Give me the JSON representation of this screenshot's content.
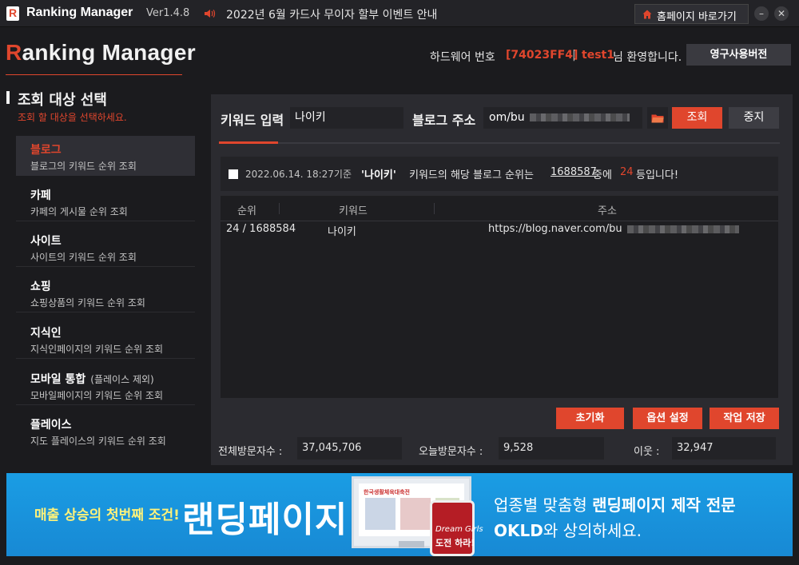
{
  "titlebar": {
    "logo_letter": "R",
    "app_name": "Ranking Manager",
    "version": "Ver1.4.8",
    "notice": "2022년 6월 카드사 무이자 할부 이벤트 안내",
    "home_label": "홈페이지 바로가기",
    "minimize": "–",
    "close": "✕"
  },
  "header": {
    "brand_r": "R",
    "brand_rest": "anking Manager",
    "hw_label": "하드웨어 번호",
    "hw_code": "[74023FF4]",
    "hw_sep": "|",
    "user": "test1",
    "welcome": "님 환영합니다.",
    "permanent_label": "영구사용버전"
  },
  "sidebar": {
    "title": "조회 대상 선택",
    "subtitle": "조회 할 대상을 선택하세요.",
    "items": [
      {
        "title": "블로그",
        "note": "",
        "desc": "블로그의 키워드 순위 조회"
      },
      {
        "title": "카페",
        "note": "",
        "desc": "카페의 게시물 순위 조회"
      },
      {
        "title": "사이트",
        "note": "",
        "desc": "사이트의 키워드 순위 조회"
      },
      {
        "title": "쇼핑",
        "note": "",
        "desc": "쇼핑상품의 키워드 순위 조회"
      },
      {
        "title": "지식인",
        "note": "",
        "desc": "지식인페이지의 키워드 순위 조회"
      },
      {
        "title": "모바일 통합",
        "note": "(플레이스 제외)",
        "desc": "모바일페이지의 키워드 순위 조회"
      },
      {
        "title": "플레이스",
        "note": "",
        "desc": "지도 플레이스의 키워드 순위 조회"
      }
    ]
  },
  "search": {
    "keyword_label": "키워드 입력",
    "keyword_value": "나이키",
    "blog_label": "블로그 주소",
    "blog_value": "om/bu",
    "search_button": "조회",
    "stop_button": "중지"
  },
  "result": {
    "timestamp": "2022.06.14. 18:27기준",
    "keyword": "'나이키'",
    "text1": "키워드의 해당 블로그 순위는",
    "total": "1688587",
    "text2": "중에",
    "rank": "24",
    "text3": "등입니다!"
  },
  "table": {
    "headers": [
      "순위",
      "키워드",
      "주소"
    ],
    "rows": [
      {
        "rank": "24 / 1688584",
        "keyword": "나이키",
        "url": "https://blog.naver.com/bu"
      }
    ]
  },
  "actions": {
    "reset": "초기화",
    "options": "옵션 설정",
    "save": "작업 저장"
  },
  "stats": {
    "total_label": "전체방문자수 :",
    "total_value": "37,045,706",
    "today_label": "오늘방문자수 :",
    "today_value": "9,528",
    "neighbor_label": "이웃 :",
    "neighbor_value": "32,947"
  },
  "banner": {
    "sub": "매출 상승의 첫번째 조건!",
    "main": "랜딩페이지",
    "screen_header": "한국생활체육대축전",
    "phone_line1": "Dream Girls",
    "phone_line2": "도전 하라!",
    "right1_pre": "업종별 맞춤형 ",
    "right1_bold": "랜딩페이지 제작 전문",
    "right2_bold": "OKLD",
    "right2_post": "와 상의하세요."
  },
  "colors": {
    "accent": "#e0462d",
    "background": "#1b1b1e",
    "panel": "#2b2b30",
    "banner": "#1a9de4"
  }
}
